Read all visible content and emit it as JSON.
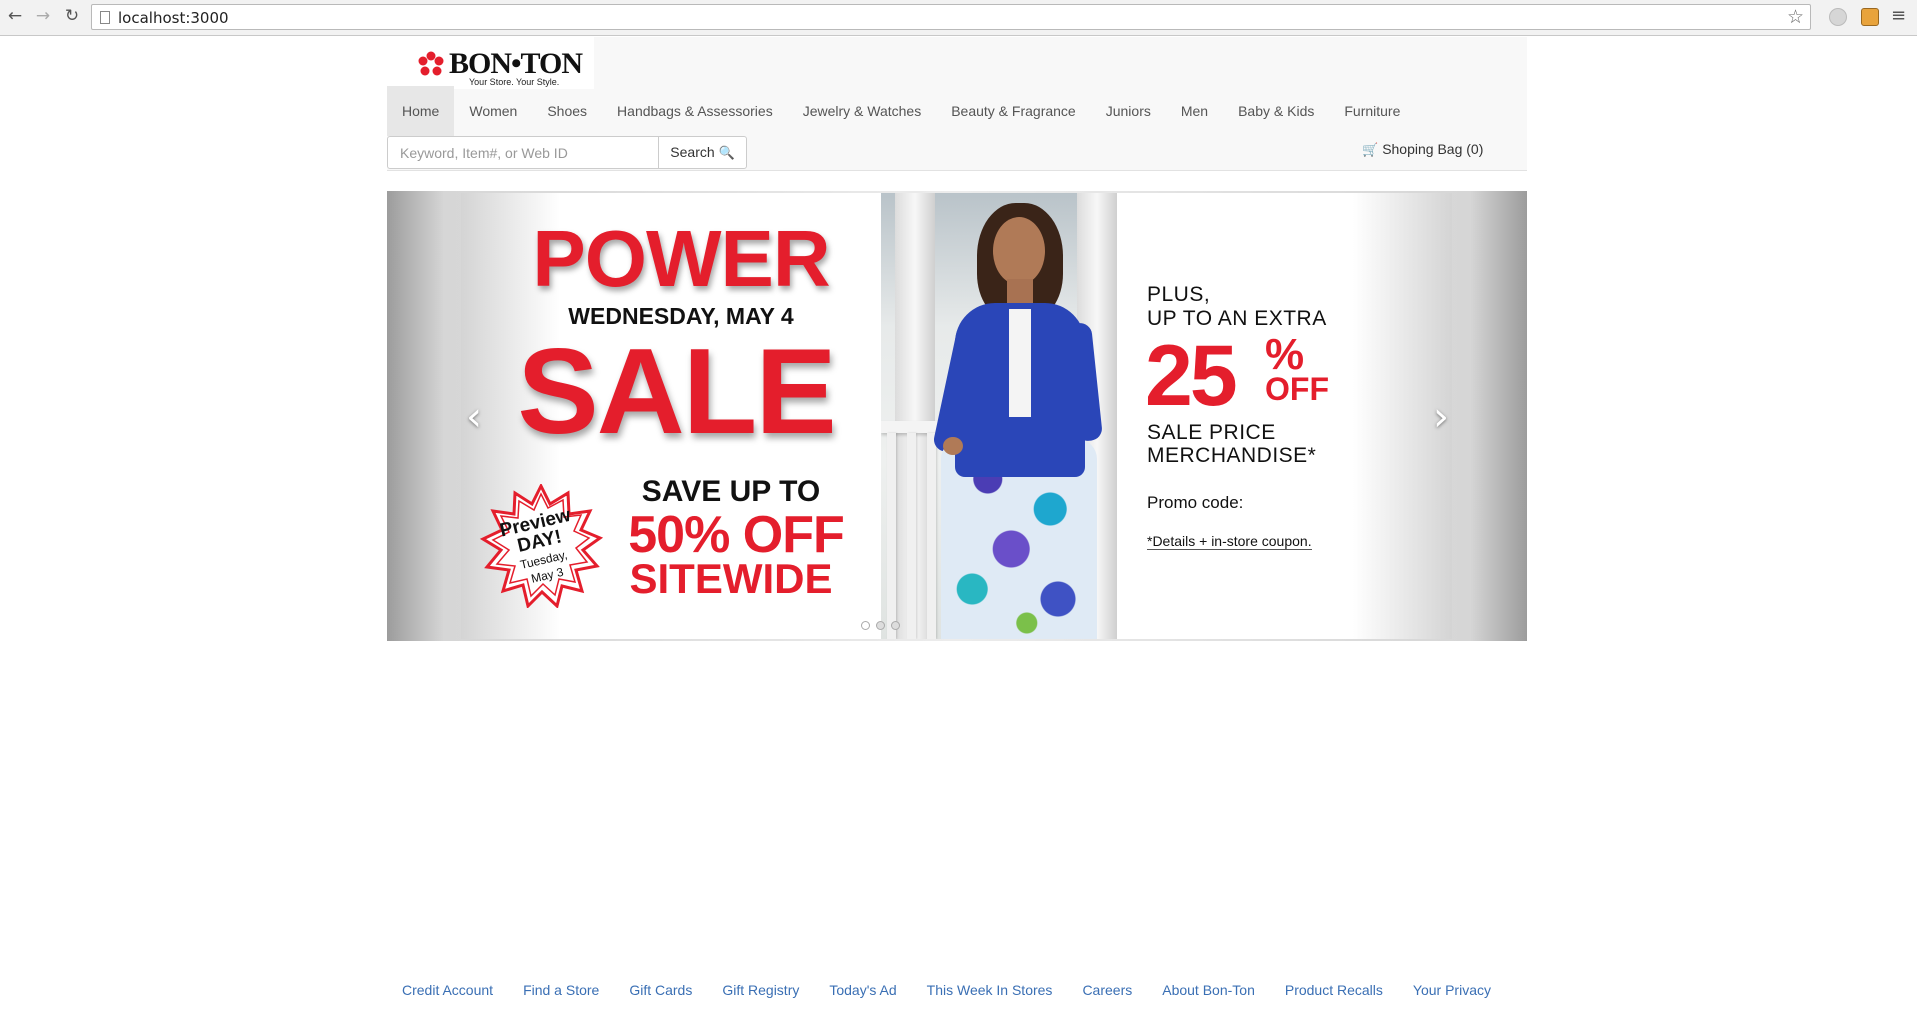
{
  "browser": {
    "url": "localhost:3000",
    "back_icon": "back-arrow-icon",
    "forward_icon": "forward-arrow-icon",
    "reload_icon": "reload-icon"
  },
  "site": {
    "brand": "BON•TON",
    "tagline": "Your Store. Your Style.",
    "nav": [
      {
        "label": "Home",
        "active": true
      },
      {
        "label": "Women",
        "active": false
      },
      {
        "label": "Shoes",
        "active": false
      },
      {
        "label": "Handbags & Assessories",
        "active": false
      },
      {
        "label": "Jewelry & Watches",
        "active": false
      },
      {
        "label": "Beauty & Fragrance",
        "active": false
      },
      {
        "label": "Juniors",
        "active": false
      },
      {
        "label": "Men",
        "active": false
      },
      {
        "label": "Baby & Kids",
        "active": false
      },
      {
        "label": "Furniture",
        "active": false
      }
    ],
    "search": {
      "placeholder": "Keyword, Item#, or Web ID",
      "value": "",
      "button_label": "Search"
    },
    "bag": {
      "label": "Shoping Bag (0)"
    }
  },
  "banner": {
    "headline_top": "POWER",
    "date": "WEDNESDAY, MAY 4",
    "headline_bottom": "SALE",
    "save_line1": "SAVE UP TO",
    "save_line2": "50% OFF",
    "save_line3": "SITEWIDE",
    "preview_line1": "Preview",
    "preview_line2": "DAY!",
    "preview_line3": "Tuesday,",
    "preview_line4": "May 3",
    "plus_line1": "PLUS,",
    "plus_line2": "UP TO AN EXTRA",
    "extra_number": "25",
    "extra_pct": "%",
    "extra_off": "OFF",
    "sale_line1": "SALE PRICE",
    "sale_line2": "MERCHANDISE*",
    "promo": "Promo code:",
    "details": "*Details + in-store coupon.",
    "prev_label": "‹",
    "next_label": "›",
    "slide_count": 3,
    "active_slide": 1
  },
  "footer": {
    "links": [
      "Credit Account",
      "Find a Store",
      "Gift Cards",
      "Gift Registry",
      "Today's Ad",
      "This Week In Stores",
      "Careers",
      "About Bon-Ton",
      "Product Recalls",
      "Your Privacy"
    ]
  },
  "colors": {
    "brand_red": "#e41e2c",
    "link_blue": "#3a6fb4",
    "nav_active_bg": "#e7e7e7",
    "header_bg": "#f8f8f8"
  }
}
